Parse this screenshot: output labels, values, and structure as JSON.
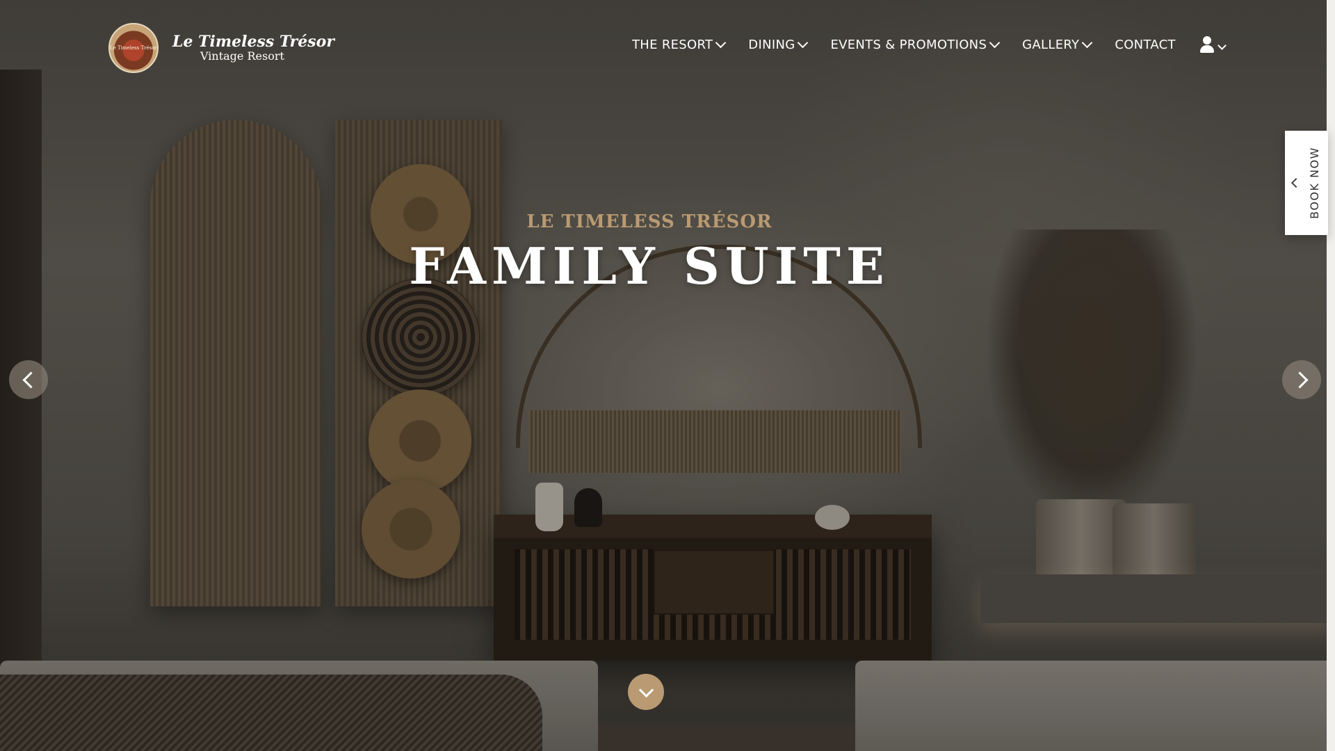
{
  "header": {
    "logo": {
      "name": "Le Timeless Trésor",
      "subtitle": "Vintage Resort",
      "emblem_text": "Le Timeless Trésor"
    },
    "nav": [
      {
        "label": "THE RESORT",
        "has_dropdown": true
      },
      {
        "label": "DINING",
        "has_dropdown": true
      },
      {
        "label": "EVENTS & PROMOTIONS",
        "has_dropdown": true
      },
      {
        "label": "GALLERY",
        "has_dropdown": true
      },
      {
        "label": "CONTACT",
        "has_dropdown": false
      }
    ],
    "user_menu": {
      "icon": "user-icon",
      "has_dropdown": true
    }
  },
  "hero": {
    "eyebrow": "LE TIMELESS TRÉSOR",
    "title": "FAMILY SUITE",
    "prev_icon": "chevron-left-icon",
    "next_icon": "chevron-right-icon",
    "scroll_icon": "chevron-down-icon"
  },
  "book_now": {
    "label": "BOOK NOW",
    "icon": "chevron-left-icon"
  },
  "colors": {
    "accent_gold": "#b99a72",
    "nav_text": "#ffffff",
    "title_text": "#ffffff",
    "book_tab_bg": "#ffffff"
  }
}
